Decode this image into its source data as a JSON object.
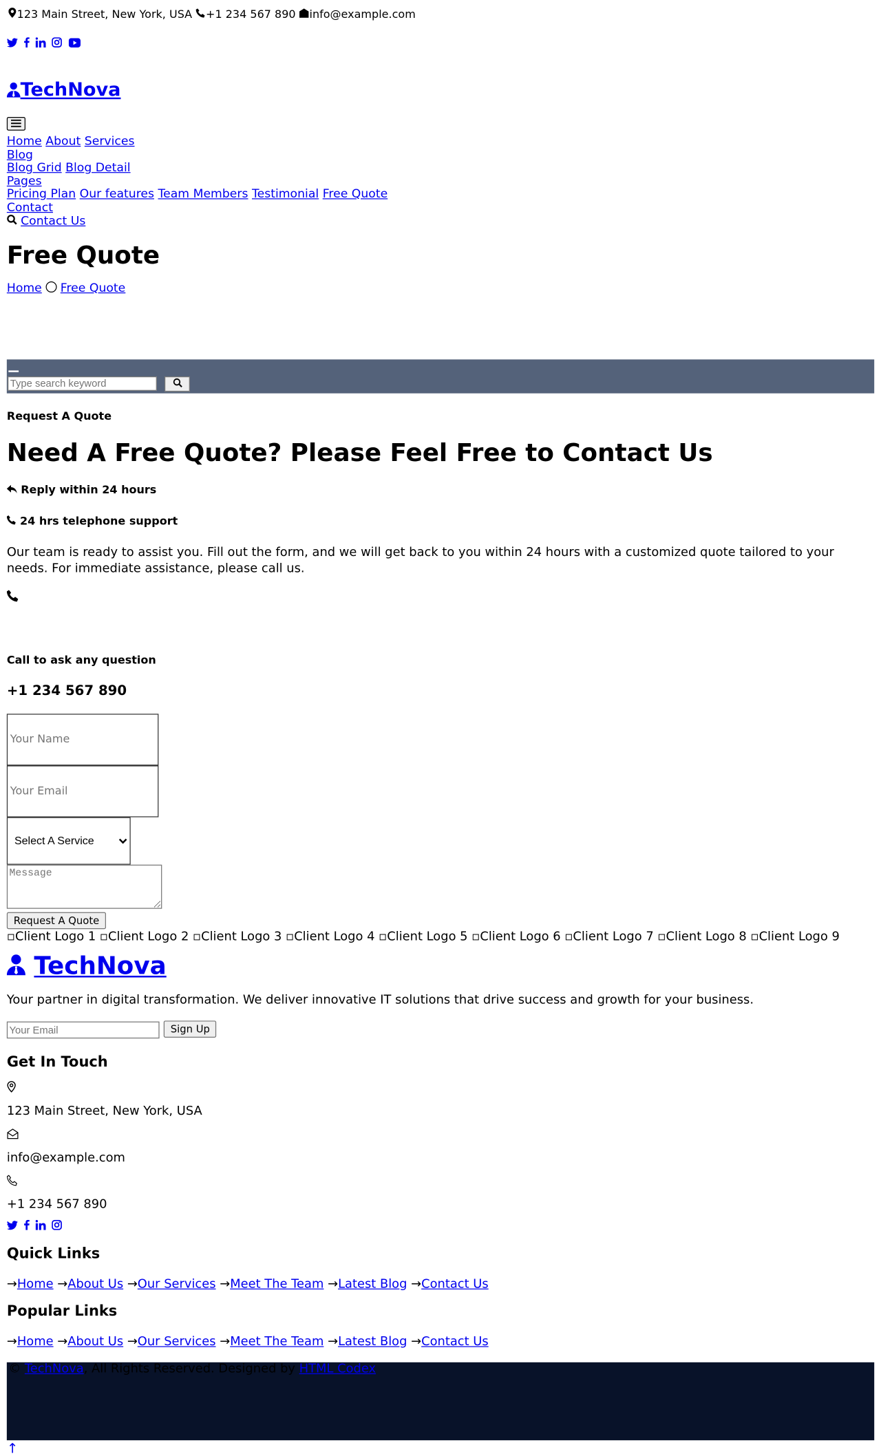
{
  "topbar": {
    "address": "123 Main Street, New York, USA",
    "phone": "+1 234 567 890",
    "email": "info@example.com"
  },
  "social": [
    "twitter-icon",
    "facebook-icon",
    "linkedin-icon",
    "instagram-icon",
    "youtube-icon"
  ],
  "brand": {
    "name": "TechNova"
  },
  "nav": {
    "home": "Home",
    "about": "About",
    "services": "Services",
    "blog": "Blog",
    "blog_grid": "Blog Grid",
    "blog_detail": "Blog Detail",
    "pages": "Pages",
    "pricing": "Pricing Plan",
    "features": "Our features",
    "team": "Team Members",
    "testimonial": "Testimonial",
    "free_quote": "Free Quote",
    "contact": "Contact",
    "contact_us": "Contact Us"
  },
  "header": {
    "title": "Free Quote",
    "breadcrumb_home": "Home",
    "breadcrumb_current": "Free Quote"
  },
  "search": {
    "placeholder": "Type search keyword"
  },
  "quote": {
    "subtitle": "Request A Quote",
    "title": "Need A Free Quote? Please Feel Free to Contact Us",
    "feature1": "Reply within 24 hours",
    "feature2": "24 hrs telephone support",
    "description": "Our team is ready to assist you. Fill out the form, and we will get back to you within 24 hours with a customized quote tailored to your needs. For immediate assistance, please call us.",
    "call_label": "Call to ask any question",
    "call_number": "+1 234 567 890"
  },
  "form": {
    "name_placeholder": "Your Name",
    "email_placeholder": "Your Email",
    "service_selected": "Select A Service",
    "message_placeholder": "Message",
    "submit": "Request A Quote"
  },
  "clients": [
    "Client Logo 1",
    "Client Logo 2",
    "Client Logo 3",
    "Client Logo 4",
    "Client Logo 5",
    "Client Logo 6",
    "Client Logo 7",
    "Client Logo 8",
    "Client Logo 9"
  ],
  "footer": {
    "tagline": "Your partner in digital transformation. We deliver innovative IT solutions that drive success and growth for your business.",
    "newsletter_placeholder": "Your Email",
    "signup": "Sign Up",
    "get_in_touch": "Get In Touch",
    "address": "123 Main Street, New York, USA",
    "email": "info@example.com",
    "phone": "+1 234 567 890",
    "quick_links_title": "Quick Links",
    "popular_links_title": "Popular Links",
    "links": [
      "Home",
      "About Us",
      "Our Services",
      "Meet The Team",
      "Latest Blog",
      "Contact Us"
    ],
    "copyright_brand": "TechNova",
    "copyright_text": ", All Rights Reserved. Designed by",
    "designer": "HTML Codex"
  },
  "colors": {
    "search_band": "#54627a",
    "footer_bar": "#081229",
    "link": "#0000ee"
  }
}
